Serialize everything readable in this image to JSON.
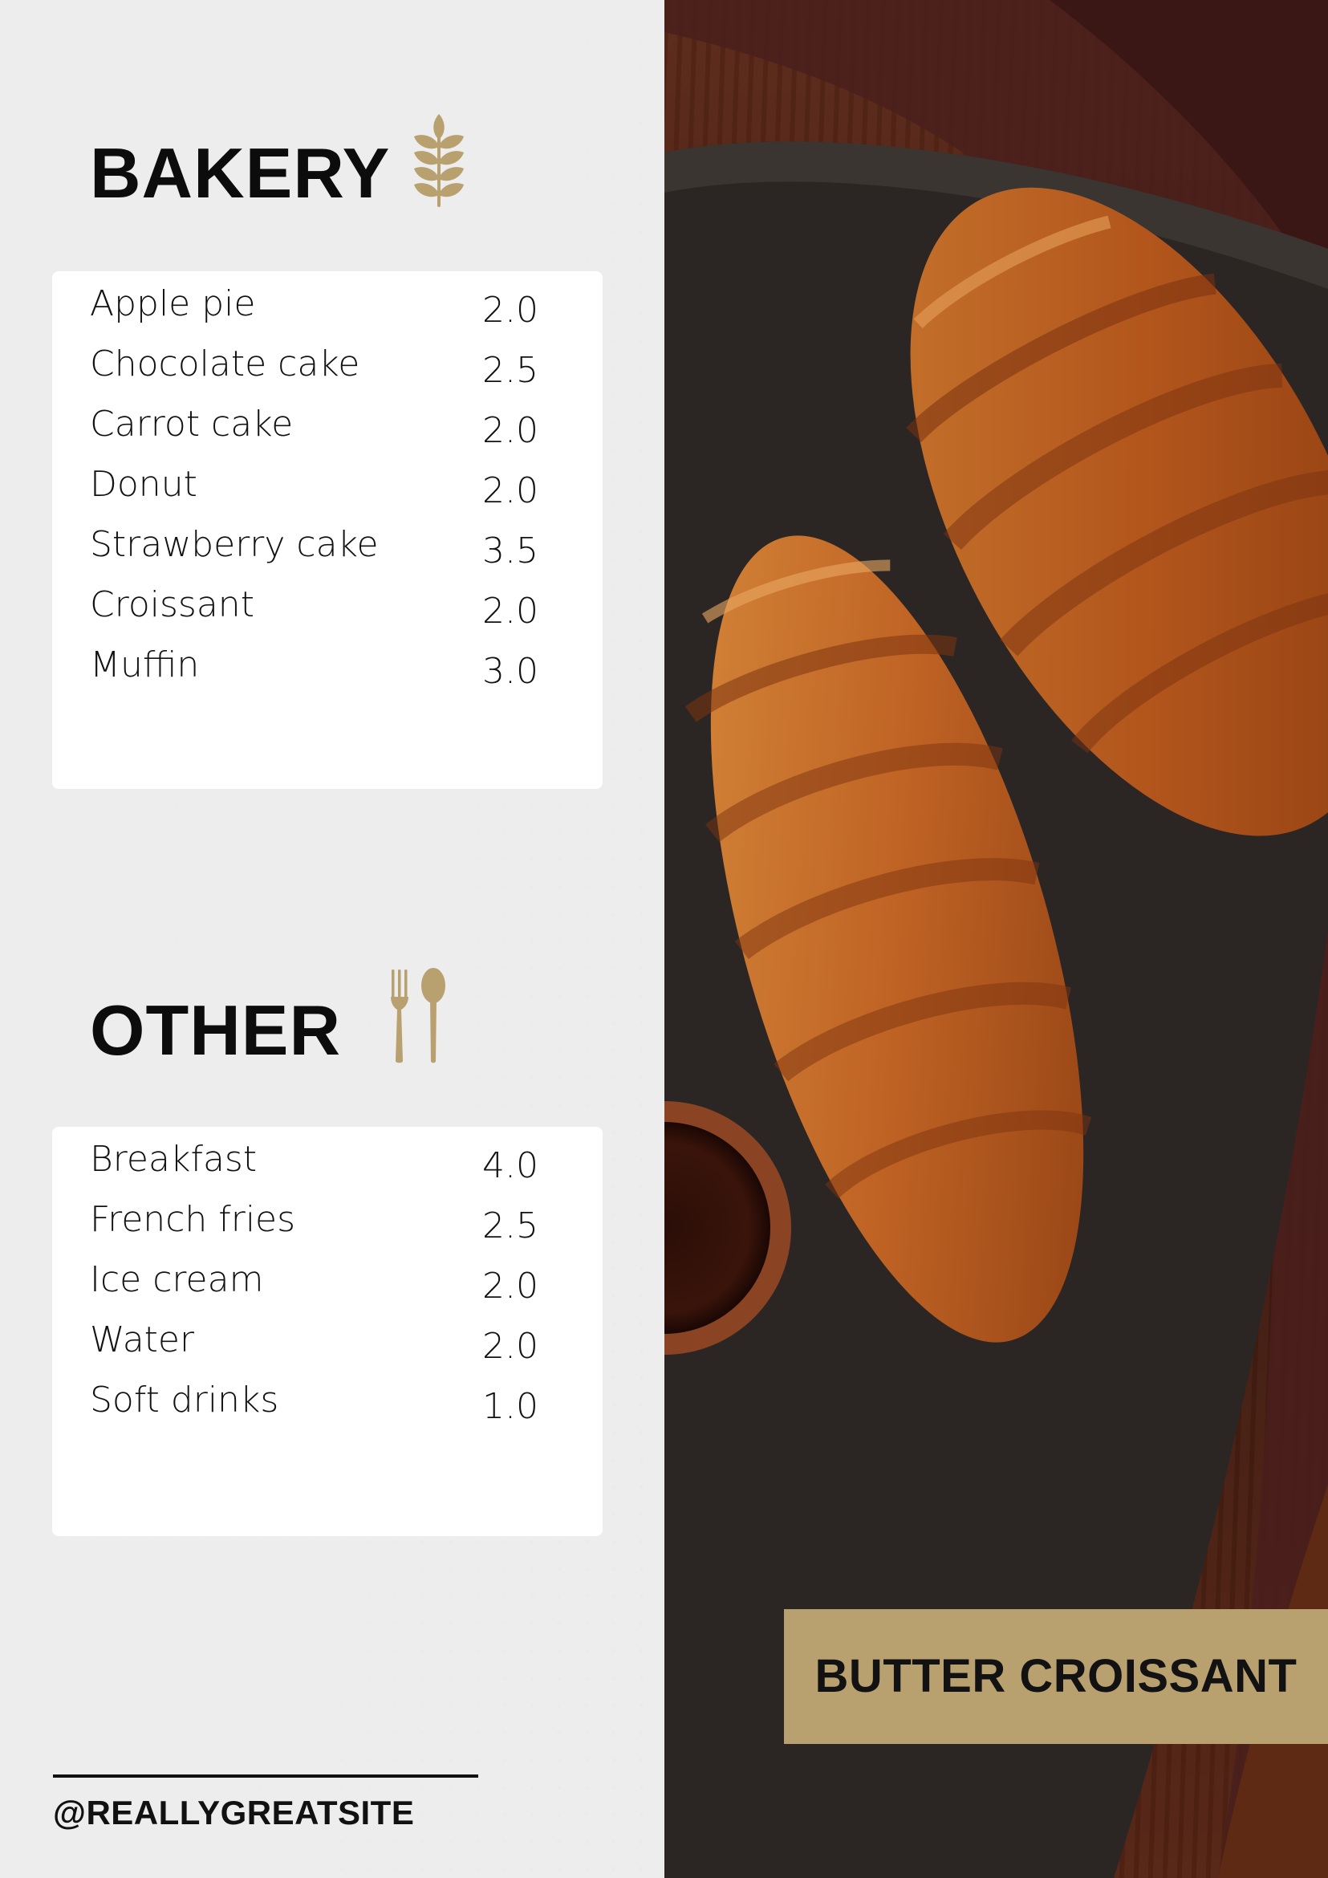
{
  "bakery": {
    "title": "BAKERY",
    "icon": "wheat-icon",
    "items": [
      {
        "name": "Apple pie",
        "price": "2.0"
      },
      {
        "name": "Chocolate cake",
        "price": "2.5"
      },
      {
        "name": "Carrot cake",
        "price": "2.0"
      },
      {
        "name": "Donut",
        "price": "2.0"
      },
      {
        "name": "Strawberry cake",
        "price": "3.5"
      },
      {
        "name": "Croissant",
        "price": "2.0"
      },
      {
        "name": "Muffin",
        "price": "3.0"
      }
    ]
  },
  "other": {
    "title": "OTHER",
    "icon": "fork-spoon-icon",
    "items": [
      {
        "name": "Breakfast",
        "price": "4.0"
      },
      {
        "name": "French fries",
        "price": "2.5"
      },
      {
        "name": "Ice cream",
        "price": "2.0"
      },
      {
        "name": "Water",
        "price": "2.0"
      },
      {
        "name": "Soft drinks",
        "price": "1.0"
      }
    ]
  },
  "photo": {
    "caption": "BUTTER CROISSANT"
  },
  "footer": {
    "handle": "@REALLYGREATSITE"
  },
  "colors": {
    "accent": "#b9a06f",
    "background": "#ededed",
    "card": "#ffffff",
    "text": "#121212"
  }
}
